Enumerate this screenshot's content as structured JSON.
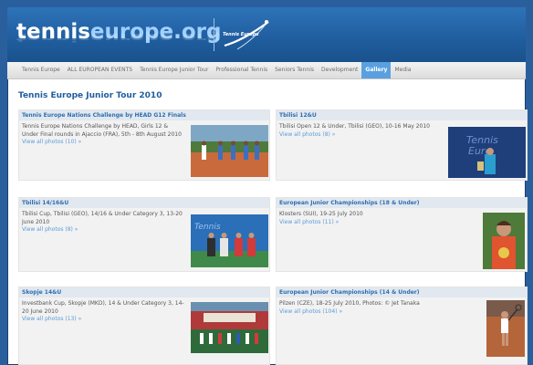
{
  "header": {
    "logo": {
      "brand": "tennis",
      "rest": "europe.org"
    },
    "badge_text": "Tennis Europe"
  },
  "nav": {
    "items": [
      {
        "label": "Tennis Europe"
      },
      {
        "label": "ALL EUROPEAN EVENTS"
      },
      {
        "label": "Tennis Europe Junior Tour"
      },
      {
        "label": "Professional Tennis"
      },
      {
        "label": "Seniors Tennis"
      },
      {
        "label": "Development"
      },
      {
        "label": "Gallery",
        "active": true
      },
      {
        "label": "Media"
      }
    ]
  },
  "page": {
    "title": "Tennis Europe Junior Tour 2010"
  },
  "cards": [
    {
      "title": "Tennis Europe Nations Challenge by HEAD G12 Finals",
      "desc": "Tennis Europe Nations Challenge by HEAD, Girls 12 & Under Final rounds in Ajaccio (FRA), 5th - 8th August 2010",
      "link": "View all photos (10) »"
    },
    {
      "title": "Tbilisi 12&U",
      "desc": "Tbilisi Open 12 & Under, Tbilisi (GEO), 10-16 May 2010",
      "link": "View all photos (8) »"
    },
    {
      "title": "Tbilisi 14/16&U",
      "desc": "Tbilisi Cup, Tbilisi (GEO), 14/16 & Under Category 3, 13-20 June 2010",
      "link": "View all photos (8) »"
    },
    {
      "title": "European Junior Championships (18 & Under)",
      "desc": "Klosters (SUI), 19-25 July 2010",
      "link": "View all photos (11) »"
    },
    {
      "title": "Skopje 14&U",
      "desc": "Investbank Cup, Skopje (MKD), 14 & Under Category 3, 14-20 June 2010",
      "link": "View all photos (13) »"
    },
    {
      "title": "European Junior Championships (14 & Under)",
      "desc": "Pilzen (CZE), 18-25 July 2010, Photos: © Jet Tanaka",
      "link": "View all photos (104) »"
    }
  ],
  "colors": {
    "brand_blue": "#1f5d9e",
    "link_blue": "#5a9bd8",
    "active_tab": "#5aa0e0"
  }
}
